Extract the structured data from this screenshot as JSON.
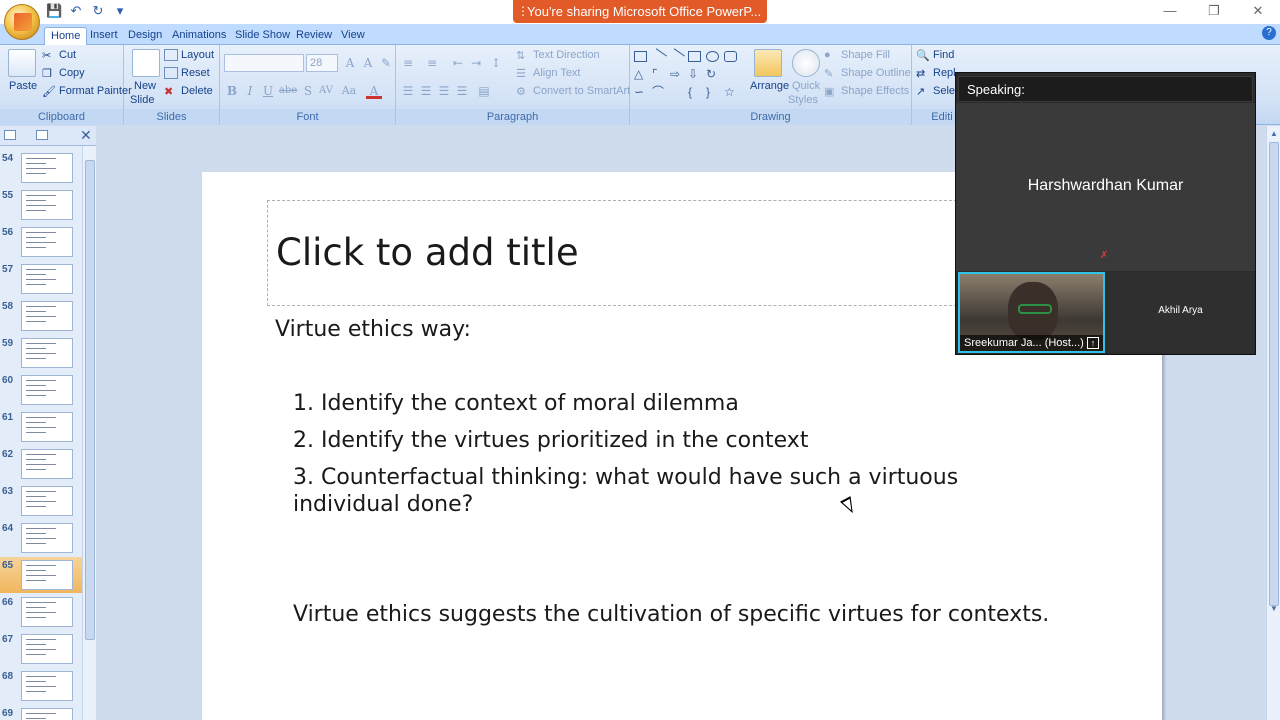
{
  "window": {
    "share_banner": "You're sharing Microsoft Office PowerP...",
    "controls": {
      "minimize": "—",
      "restore": "❐",
      "close": "✕"
    },
    "qat_icons": [
      "save-icon",
      "undo-icon",
      "redo-icon",
      "customize-icon"
    ]
  },
  "tabs": [
    "Home",
    "Insert",
    "Design",
    "Animations",
    "Slide Show",
    "Review",
    "View"
  ],
  "active_tab": "Home",
  "ribbon": {
    "clipboard": {
      "paste": "Paste",
      "cut": "Cut",
      "copy": "Copy",
      "format_painter": "Format Painter",
      "label": "Clipboard"
    },
    "slides": {
      "new_slide": "New",
      "new_slide2": "Slide",
      "layout": "Layout",
      "reset": "Reset",
      "delete": "Delete",
      "label": "Slides"
    },
    "font": {
      "size": "28",
      "label": "Font",
      "buttons": [
        "B",
        "I",
        "U",
        "abe",
        "S",
        "AV",
        "Aa",
        "A"
      ]
    },
    "paragraph": {
      "text_direction": "Text Direction",
      "align_text": "Align Text",
      "convert_smartart": "Convert to SmartArt",
      "label": "Paragraph"
    },
    "drawing": {
      "arrange": "Arrange",
      "quick_styles": "Quick",
      "quick_styles2": "Styles",
      "shape_fill": "Shape Fill",
      "shape_outline": "Shape Outline",
      "shape_effects": "Shape Effects",
      "label": "Drawing"
    },
    "editing": {
      "find": "Find",
      "replace": "Repl",
      "select": "Selec",
      "label": "Editi"
    }
  },
  "slide_thumbs": [
    {
      "num": "54",
      "selected": false
    },
    {
      "num": "55",
      "selected": false
    },
    {
      "num": "56",
      "selected": false
    },
    {
      "num": "57",
      "selected": false
    },
    {
      "num": "58",
      "selected": false
    },
    {
      "num": "59",
      "selected": false
    },
    {
      "num": "60",
      "selected": false
    },
    {
      "num": "61",
      "selected": false
    },
    {
      "num": "62",
      "selected": false
    },
    {
      "num": "63",
      "selected": false
    },
    {
      "num": "64",
      "selected": false
    },
    {
      "num": "65",
      "selected": true
    },
    {
      "num": "66",
      "selected": false
    },
    {
      "num": "67",
      "selected": false
    },
    {
      "num": "68",
      "selected": false
    },
    {
      "num": "69",
      "selected": false
    }
  ],
  "slide": {
    "title_placeholder": "Click to add title",
    "heading": "Virtue ethics way:",
    "items": [
      "1. Identify the context of moral dilemma",
      "2. Identify the virtues prioritized in the context",
      "3. Counterfactual thinking: what would have such a virtuous individual done?"
    ],
    "conclusion": "Virtue ethics suggests the cultivation of specific virtues for contexts."
  },
  "meeting": {
    "speaking_label": "Speaking:",
    "active_speaker": "Harshwardhan Kumar",
    "self_name": "Sreekumar Ja... (Host...)",
    "other_name": "Akhil Arya"
  }
}
